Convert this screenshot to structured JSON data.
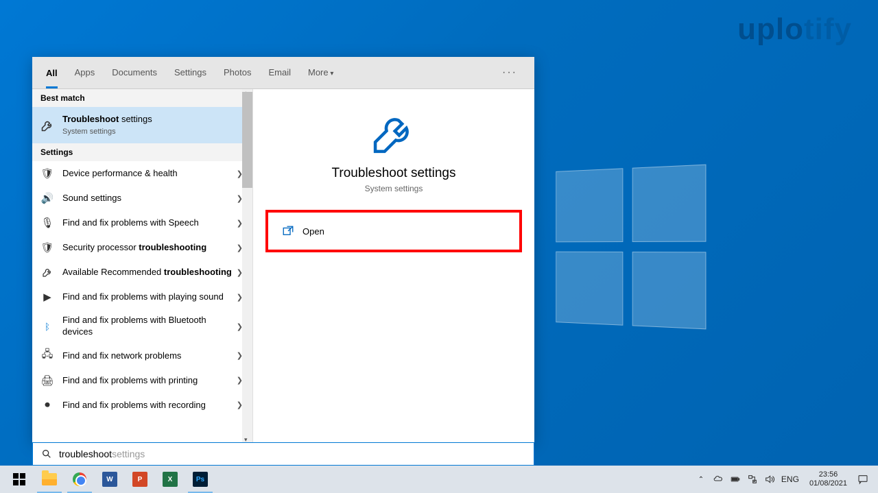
{
  "watermark": {
    "part1": "uplo",
    "part2": "tify"
  },
  "tabs": {
    "items": [
      "All",
      "Apps",
      "Documents",
      "Settings",
      "Photos",
      "Email",
      "More"
    ],
    "active_index": 0
  },
  "left": {
    "best_match_header": "Best match",
    "best": {
      "title_prefix": "Troubleshoot",
      "title_suffix": " settings",
      "subtitle": "System settings"
    },
    "settings_header": "Settings",
    "items": [
      {
        "icon": "shield",
        "text": "Device performance & health",
        "bold": ""
      },
      {
        "icon": "speaker",
        "text": "Sound settings",
        "bold": ""
      },
      {
        "icon": "mic",
        "text": "Find and fix problems with Speech",
        "bold": ""
      },
      {
        "icon": "shield",
        "pre": "Security processor ",
        "bold": "troubleshooting"
      },
      {
        "icon": "wrench",
        "pre": "Available Recommended ",
        "bold": "troubleshooting"
      },
      {
        "icon": "play",
        "text": "Find and fix problems with playing sound",
        "bold": ""
      },
      {
        "icon": "bluetooth",
        "text": "Find and fix problems with Bluetooth devices",
        "bold": ""
      },
      {
        "icon": "network",
        "text": "Find and fix network problems",
        "bold": ""
      },
      {
        "icon": "printer",
        "text": "Find and fix problems with printing",
        "bold": ""
      },
      {
        "icon": "record",
        "text": "Find and fix problems with recording",
        "bold": ""
      }
    ]
  },
  "right": {
    "title": "Troubleshoot settings",
    "subtitle": "System settings",
    "action": "Open"
  },
  "searchbox": {
    "typed": "troubleshoot",
    "suggest": " settings"
  },
  "taskbar": {
    "apps": {
      "word": "W",
      "ppt": "P",
      "excel": "X",
      "ps": "Ps"
    }
  },
  "tray": {
    "lang": "ENG",
    "time": "23:56",
    "date": "01/08/2021"
  }
}
